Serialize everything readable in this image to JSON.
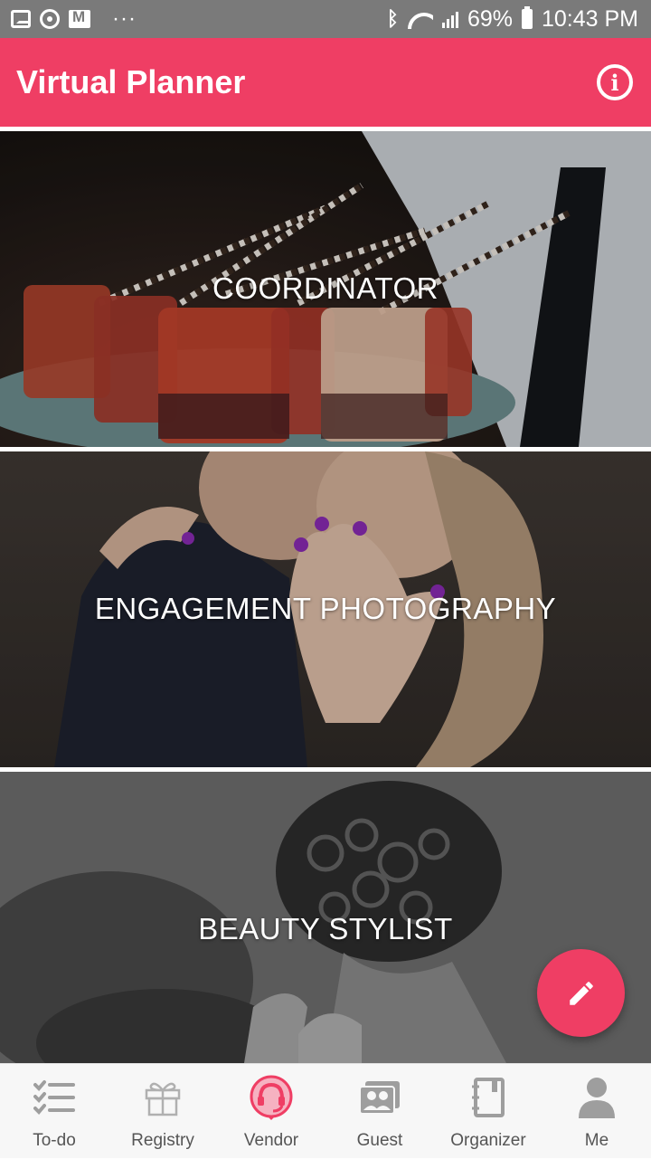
{
  "status_bar": {
    "battery": "69%",
    "time": "10:43 PM",
    "more": "···"
  },
  "app_bar": {
    "title": "Virtual Planner",
    "info_icon": "info-icon"
  },
  "cards": [
    {
      "label": "COORDINATOR",
      "image": "cocktails-photo"
    },
    {
      "label": "ENGAGEMENT PHOTOGRAPHY",
      "image": "engagement-ring-photo"
    },
    {
      "label": "BEAUTY STYLIST",
      "image": "hair-updo-photo"
    }
  ],
  "fab": {
    "icon": "pencil-icon"
  },
  "bottom_nav": {
    "items": [
      {
        "label": "To-do",
        "icon": "checklist-icon"
      },
      {
        "label": "Registry",
        "icon": "gift-icon"
      },
      {
        "label": "Vendor",
        "icon": "headset-icon",
        "active": true
      },
      {
        "label": "Guest",
        "icon": "guests-icon"
      },
      {
        "label": "Organizer",
        "icon": "notebook-icon"
      },
      {
        "label": "Me",
        "icon": "person-icon"
      }
    ]
  },
  "colors": {
    "accent": "#ef3e64",
    "status_bar": "#7a7a7a",
    "nav_bg": "#f7f7f7",
    "nav_icon": "#9e9e9e"
  }
}
